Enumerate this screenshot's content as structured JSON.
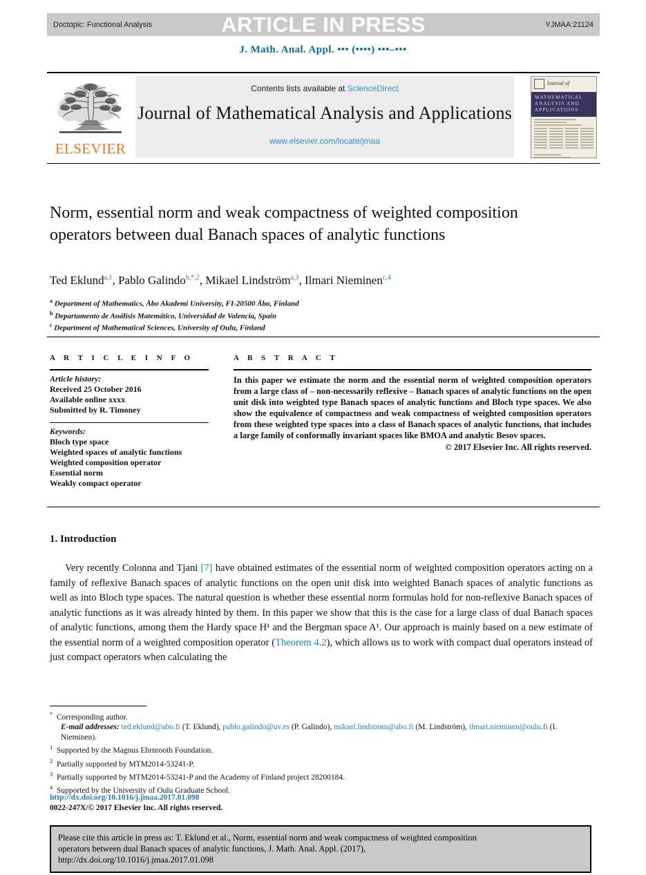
{
  "topbar": {
    "doctopic": "Doctopic: Functional Analysis",
    "stamp": "ARTICLE IN PRESS",
    "article_id": "YJMAA:21124"
  },
  "journal_ref": "J. Math. Anal. Appl. ••• (••••) •••–•••",
  "masthead": {
    "publisher_word": "ELSEVIER",
    "publisher_logo_icon": "elsevier-tree-logo",
    "contents_prefix": "Contents lists available at",
    "contents_link": "ScienceDirect",
    "journal_title": "Journal of Mathematical Analysis and Applications",
    "journal_url": "www.elsevier.com/locate/jmaa",
    "cover": {
      "journal_of": "Journal of",
      "band_lines": [
        "MATHEMATICAL",
        "ANALYSIS AND",
        "APPLICATIONS"
      ],
      "brand_mark": "elsevier-cover-mark"
    }
  },
  "article": {
    "title": "Norm, essential norm and weak compactness of weighted composition operators between dual Banach spaces of analytic functions",
    "authors": [
      {
        "name": "Ted Eklund",
        "marks": "a,1"
      },
      {
        "name": "Pablo Galindo",
        "marks": "b,*,2"
      },
      {
        "name": "Mikael Lindström",
        "marks": "a,3"
      },
      {
        "name": "Ilmari Nieminen",
        "marks": "c,4"
      }
    ],
    "affiliations": [
      {
        "mark": "a",
        "text": "Department of Mathematics, Åbo Akademi University, FI-20500 Åbo, Finland"
      },
      {
        "mark": "b",
        "text": "Departamento de Análisis Matemático, Universidad de Valencia, Spain"
      },
      {
        "mark": "c",
        "text": "Department of Mathematical Sciences, University of Oulu, Finland"
      }
    ]
  },
  "info": {
    "heading": "A R T I C L E   I N F O",
    "history_label": "Article history:",
    "history": [
      "Received 25 October 2016",
      "Available online xxxx",
      "Submitted by R. Timoney"
    ],
    "keywords_label": "Keywords:",
    "keywords": [
      "Bloch type space",
      "Weighted spaces of analytic functions",
      "Weighted composition operator",
      "Essential norm",
      "Weakly compact operator"
    ]
  },
  "abstract": {
    "heading": "A B S T R A C T",
    "text": "In this paper we estimate the norm and the essential norm of weighted composition operators from a large class of – non-necessarily reflexive – Banach spaces of analytic functions on the open unit disk into weighted type Banach spaces of analytic functions and Bloch type spaces. We also show the equivalence of compactness and weak compactness of weighted composition operators from these weighted type spaces into a class of Banach spaces of analytic functions, that includes a large family of conformally invariant spaces like BMOA and analytic Besov spaces.",
    "copyright": "© 2017 Elsevier Inc. All rights reserved."
  },
  "body": {
    "section_heading": "1. Introduction",
    "paragraph_1_a": "Very recently Colonna and Tjani ",
    "paragraph_ref_1": "[7]",
    "paragraph_1_b": " have obtained estimates of the essential norm of weighted composition operators acting on a family of reflexive Banach spaces of analytic functions on the open unit disk into weighted Banach spaces of analytic functions as well as into Bloch type spaces. The natural question is whether these essential norm formulas hold for non-reflexive Banach spaces of analytic functions as it was already hinted by them. In this paper we show that this is the case for a large class of dual Banach spaces of analytic functions, among them the Hardy space H¹ and the Bergman space A¹. Our approach is mainly based on a new estimate of the essential norm of a weighted composition operator (",
    "paragraph_ref_2": "Theorem 4.2",
    "paragraph_1_c": "), which allows us to work with compact dual operators instead of just compact operators when calculating the"
  },
  "footnotes": {
    "corresponding_mark": "*",
    "corresponding": "Corresponding author.",
    "email_label": "E-mail addresses:",
    "emails": [
      {
        "address": "ted.eklund@abo.fi",
        "person": "(T. Eklund),"
      },
      {
        "address": "pablo.galindo@uv.es",
        "person": "(P. Galindo),"
      },
      {
        "address": "mikael.lindstrom@abo.fi",
        "person": "(M. Lindström),"
      },
      {
        "address": "ilmari.nieminen@oulu.fi",
        "person": "(I. Nieminen)."
      }
    ],
    "numbered": [
      {
        "mark": "1",
        "text": "Supported by the Magnus Ehrnrooth Foundation."
      },
      {
        "mark": "2",
        "text": "Partially supported by MTM2014-53241-P."
      },
      {
        "mark": "3",
        "text": "Partially supported by MTM2014-53241-P and the Academy of Finland project 28200184."
      },
      {
        "mark": "4",
        "text": "Supported by the University of Oulu Graduate School."
      }
    ]
  },
  "doi_block": {
    "doi_url": "http://dx.doi.org/10.1016/j.jmaa.2017.01.098",
    "issn_line": "0022-247X/© 2017 Elsevier Inc. All rights reserved."
  },
  "citation_box": {
    "line1": "Please cite this article in press as: T. Eklund et al., Norm, essential norm and weak compactness of weighted composition",
    "line2": "operators between dual Banach spaces of analytic functions, J. Math. Anal. Appl. (2017),",
    "line3": "http://dx.doi.org/10.1016/j.jmaa.2017.01.098"
  },
  "colors": {
    "link": "#1b7fb5",
    "journal_ref": "#0b6d9e",
    "sciencedirect": "#2f93c8",
    "elsevier_orange": "#e87722",
    "bar_gray": "#c9c9c9",
    "cover_navy": "#3a3560"
  }
}
